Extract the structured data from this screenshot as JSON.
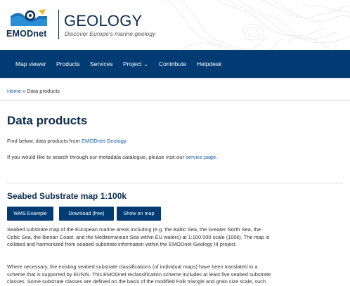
{
  "header": {
    "logo_text": "EMODnet",
    "brand_title": "GEOLOGY",
    "brand_subtitle": "Discover Europe's marine geology"
  },
  "nav": {
    "items": [
      {
        "label": "Map viewer"
      },
      {
        "label": "Products"
      },
      {
        "label": "Services"
      },
      {
        "label": "Project ⌄"
      },
      {
        "label": "Contribute"
      },
      {
        "label": "Helpdesk"
      }
    ]
  },
  "breadcrumb": {
    "home": "Home",
    "sep": " » ",
    "current": "Data products"
  },
  "page": {
    "title": "Data products",
    "intro_prefix": "Find below, data products from ",
    "intro_link": "EMODnet Geology",
    "intro_suffix": ".",
    "metadata_prefix": "If you would like to search through our metadata catalogue, please visit our ",
    "metadata_link": "service page",
    "metadata_suffix": "."
  },
  "section": {
    "title": "Seabed Substrate map 1:100k",
    "buttons": {
      "wms": "WMS Example",
      "download": "Download (free)",
      "map": "Show on map"
    },
    "para1": [
      "Seabed substrate map of the European marine areas including (e.g. the Baltic Sea, the Greater North Sea, the",
      "Celtic Sea, the Iberian Coast, and the Mediterranean Sea within EU waters) at 1:100 000 scale (100k). The map is",
      "collated and harmonized from seabed substrate information within the EMODnet-Geology III project."
    ],
    "para2": [
      "Where necessary, the existing seabed substrate classifications (of individual maps) have been translated to a",
      "scheme that is supported by EUNIS. This EMODnet reclassification scheme includes at least five seabed substrate",
      "classes. Some substrate classes are defined on the basis of the modified Folk triangle and grain size scale, such"
    ]
  }
}
